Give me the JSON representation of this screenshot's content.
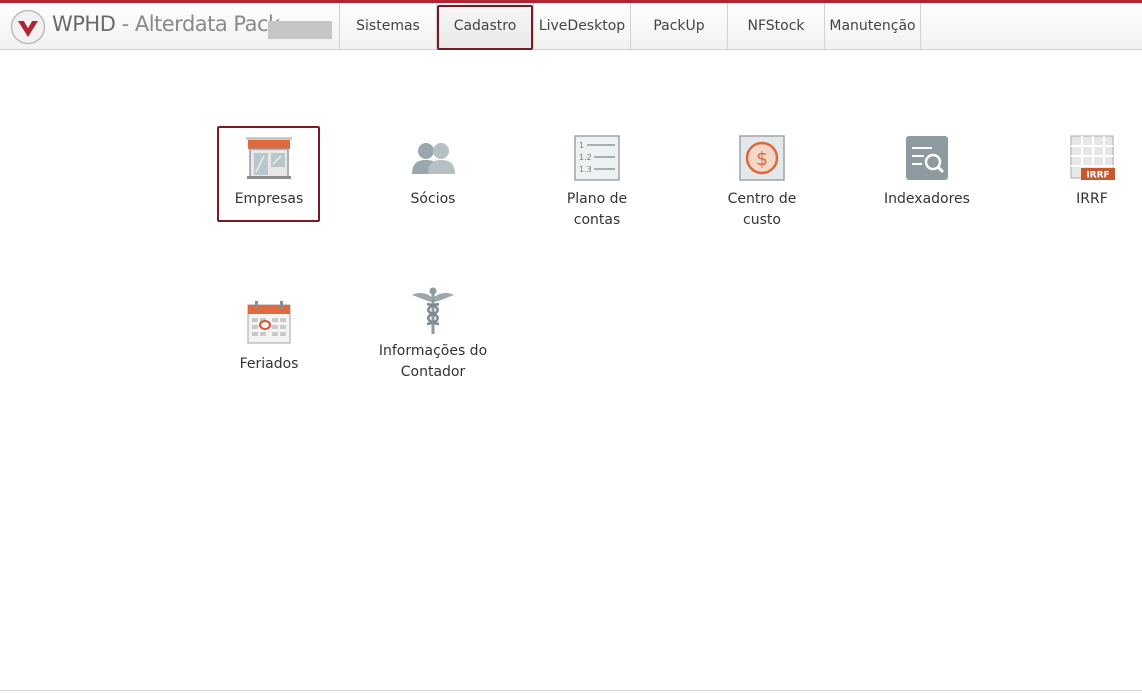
{
  "app": {
    "brand_main": "WPHD",
    "brand_sep": " - ",
    "brand_sub": "Alterdata Pack",
    "accent_color": "#b32434",
    "highlight_color": "#7b1a25"
  },
  "menu": {
    "tabs": [
      {
        "label": "Sistemas"
      },
      {
        "label": "Cadastro"
      },
      {
        "label": "LiveDesktop"
      },
      {
        "label": "PackUp"
      },
      {
        "label": "NFStock"
      },
      {
        "label": "Manutenção"
      }
    ],
    "active_tab": "Cadastro"
  },
  "items": [
    {
      "label": "Empresas",
      "icon": "storefront-icon"
    },
    {
      "label": "Sócios",
      "icon": "people-icon"
    },
    {
      "label": "Plano de contas",
      "icon": "numbered-list-icon"
    },
    {
      "label": "Centro de custo",
      "icon": "dollar-coin-icon"
    },
    {
      "label": "Indexadores",
      "icon": "list-search-icon"
    },
    {
      "label": "IRRF",
      "icon": "irrf-table-icon"
    },
    {
      "label": "Feriados",
      "icon": "calendar-icon"
    },
    {
      "label": "Informações do Contador",
      "icon": "caduceus-icon"
    }
  ],
  "selected_item": "Empresas"
}
